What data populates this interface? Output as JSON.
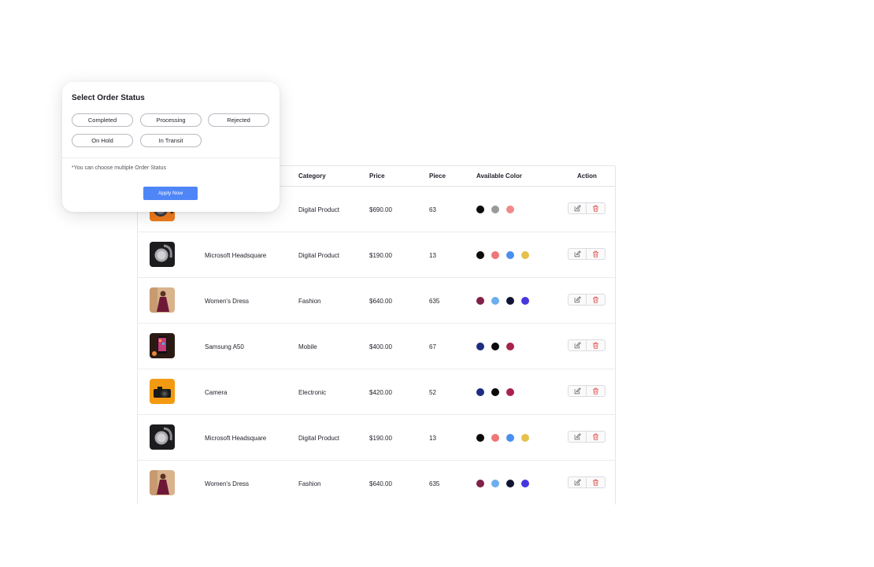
{
  "table": {
    "headers": {
      "category": "Category",
      "price": "Price",
      "piece": "Piece",
      "available_color": "Available Color",
      "action": "Action"
    },
    "rows": [
      {
        "thumb": "headset-orange",
        "name": "",
        "category": "Digital Product",
        "price": "$690.00",
        "piece": "63",
        "colors": [
          "#0b0b0b",
          "#9a9a9a",
          "#ee8a8a"
        ]
      },
      {
        "thumb": "headset-dark",
        "name": "Microsoft Headsquare",
        "category": "Digital Product",
        "price": "$190.00",
        "piece": "13",
        "colors": [
          "#0b0b0b",
          "#ee7777",
          "#4a8ef0",
          "#e6c04c"
        ]
      },
      {
        "thumb": "dress",
        "name": "Women's Dress",
        "category": "Fashion",
        "price": "$640.00",
        "piece": "635",
        "colors": [
          "#7f2148",
          "#6caeee",
          "#121433",
          "#4637dd"
        ]
      },
      {
        "thumb": "phone",
        "name": "Samsung A50",
        "category": "Mobile",
        "price": "$400.00",
        "piece": "67",
        "colors": [
          "#1d2e80",
          "#0b0b0b",
          "#a8234c"
        ]
      },
      {
        "thumb": "camera",
        "name": "Camera",
        "category": "Electronic",
        "price": "$420.00",
        "piece": "52",
        "colors": [
          "#1d2e80",
          "#0b0b0b",
          "#a8234c"
        ]
      },
      {
        "thumb": "headset-dark",
        "name": "Microsoft Headsquare",
        "category": "Digital Product",
        "price": "$190.00",
        "piece": "13",
        "colors": [
          "#0b0b0b",
          "#ee7777",
          "#4a8ef0",
          "#e6c04c"
        ]
      },
      {
        "thumb": "dress",
        "name": "Women's Dress",
        "category": "Fashion",
        "price": "$640.00",
        "piece": "635",
        "colors": [
          "#7f2148",
          "#6caeee",
          "#121433",
          "#4637dd"
        ]
      }
    ],
    "action_icons": [
      "edit-icon",
      "trash-icon"
    ]
  },
  "popup": {
    "title": "Select Order Status",
    "chips": [
      "Completed",
      "Processing",
      "Rejected",
      "On Hold",
      "In Transit"
    ],
    "note": "*You can choose multiple Order Status",
    "apply_label": "Apply Now",
    "apply_color": "#4f86f7"
  }
}
